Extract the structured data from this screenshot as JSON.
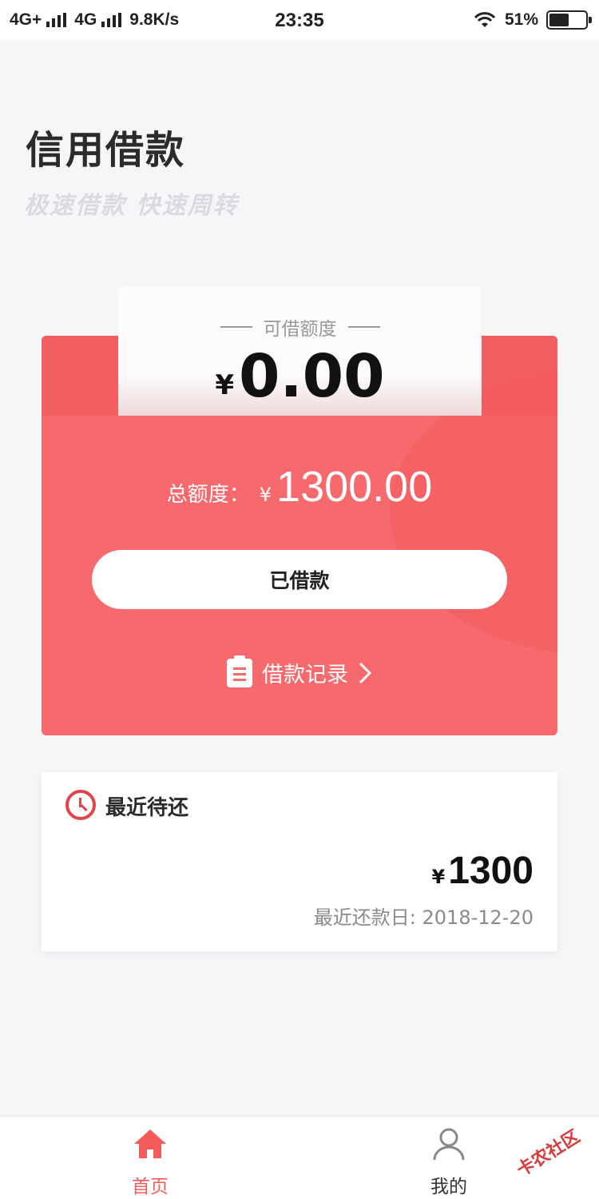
{
  "status_bar": {
    "network1": "4G+",
    "network2": "4G",
    "speed": "9.8K/s",
    "time": "23:35",
    "battery": "51%",
    "battery_level": 0.51
  },
  "header": {
    "title": "信用借款",
    "subtitle": "极速借款 快速周转"
  },
  "credit_card": {
    "available_label": "可借额度",
    "currency": "¥",
    "available_amount": "0.00",
    "total_label": "总额度：",
    "total_amount": "1300.00",
    "button_label": "已借款",
    "records_label": "借款记录",
    "records_chevron": ">"
  },
  "repay_card": {
    "title": "最近待还",
    "currency": "¥",
    "amount": "1300",
    "date_text": "最近还款日: 2018-12-20"
  },
  "bottom_nav": {
    "home_label": "首页",
    "mine_label": "我的"
  },
  "watermark": "卡农社区",
  "colors": {
    "accent": "#f45c5c",
    "card_red": "#f66a6d",
    "clock_red": "#e3444a"
  },
  "icons": {
    "home": "home-icon",
    "user": "user-icon",
    "clock": "clock-icon",
    "document": "document-icon",
    "chevron": "chevron-right-icon",
    "wifi": "wifi-icon",
    "battery": "battery-icon"
  }
}
